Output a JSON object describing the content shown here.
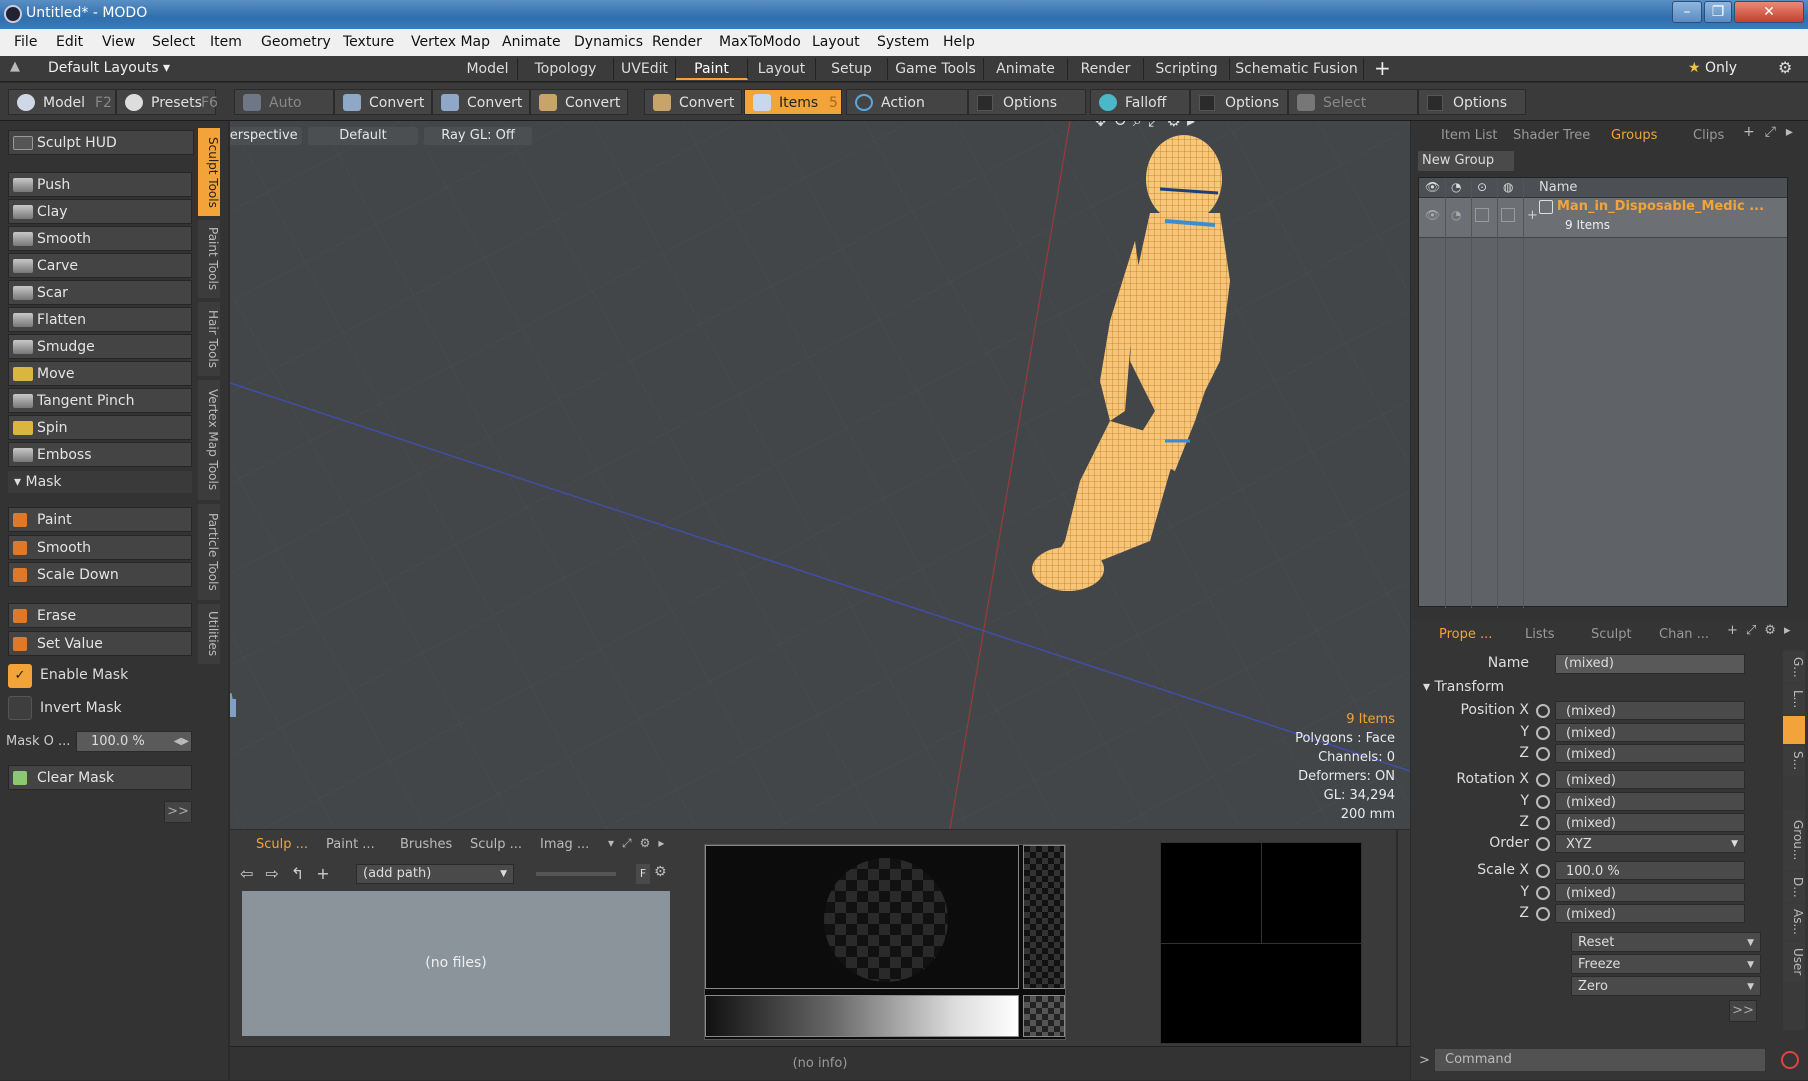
{
  "window": {
    "title": "Untitled* - MODO"
  },
  "menu": [
    "File",
    "Edit",
    "View",
    "Select",
    "Item",
    "Geometry",
    "Texture",
    "Vertex Map",
    "Animate",
    "Dynamics",
    "Render",
    "MaxToModo",
    "Layout",
    "System",
    "Help"
  ],
  "layouts": {
    "dropdown": "Default Layouts",
    "tabs": [
      "Model",
      "Topology",
      "UVEdit",
      "Paint",
      "Layout",
      "Setup",
      "Game Tools",
      "Animate",
      "Render",
      "Scripting",
      "Schematic Fusion"
    ],
    "active": "Paint",
    "plus": "+",
    "only": "Only"
  },
  "toolbar": {
    "model": "Model",
    "model_key": "F2",
    "presets": "Presets",
    "presets_key": "F6",
    "auto_select": "Auto Select",
    "convert": "Convert",
    "items": "Items",
    "items_key": "5",
    "action_center": "Action Center",
    "options": "Options",
    "falloff": "Falloff",
    "select_through": "Select Through"
  },
  "sculpt_tools": {
    "hud": "Sculpt HUD",
    "tools": [
      "Push",
      "Clay",
      "Smooth",
      "Carve",
      "Scar",
      "Flatten",
      "Smudge",
      "Move",
      "Tangent Pinch",
      "Spin",
      "Emboss"
    ],
    "mask_header": "Mask",
    "mask_tools": [
      "Paint",
      "Smooth",
      "Scale Down"
    ],
    "erase": "Erase",
    "set_value": "Set Value",
    "enable_mask": "Enable Mask",
    "invert_mask": "Invert Mask",
    "mask_opacity_label": "Mask O ...",
    "mask_opacity_value": "100.0 %",
    "clear_mask": "Clear Mask",
    "more": ">>"
  },
  "vertical_tabs": [
    "Sculpt Tools",
    "Paint Tools",
    "Hair Tools",
    "Vertex Map Tools",
    "Particle Tools",
    "Utilities"
  ],
  "viewport": {
    "view": "Perspective",
    "shading": "Default",
    "raygl": "Ray GL: Off",
    "stats": {
      "items": "9 Items",
      "polygons": "Polygons : Face",
      "channels": "Channels: 0",
      "deformers": "Deformers: ON",
      "gl": "GL: 34,294",
      "scale": "200 mm"
    }
  },
  "bottom": {
    "tabs": [
      "Sculp ...",
      "Paint ...",
      "Brushes",
      "Sculp ...",
      "Imag ..."
    ],
    "path": "(add path)",
    "nofiles": "(no files)",
    "f": "F"
  },
  "status": {
    "info": "(no info)"
  },
  "outliner": {
    "tabs": [
      "Item List",
      "Shader Tree",
      "Groups",
      "Clips"
    ],
    "new_group": "New Group",
    "col_name": "Name",
    "group_name": "Man_in_Disposable_Medic ...",
    "group_count": "9 Items"
  },
  "properties": {
    "tabs": [
      "Prope ...",
      "Lists",
      "Sculpt",
      "Chan ..."
    ],
    "name_label": "Name",
    "name_value": "(mixed)",
    "transform": "Transform",
    "pos_x": "Position X",
    "rot_x": "Rotation X",
    "scale_x": "Scale X",
    "y": "Y",
    "z": "Z",
    "order": "Order",
    "mixed": "(mixed)",
    "order_value": "XYZ",
    "scale_value": "100.0 %",
    "reset": "Reset",
    "freeze": "Freeze",
    "zero": "Zero",
    "more": ">>",
    "side_tabs": [
      "G...",
      "L...",
      "S...",
      "Grou...",
      "D...",
      "As...",
      "User"
    ]
  },
  "command": {
    "placeholder": "Command",
    "prompt": ">"
  }
}
